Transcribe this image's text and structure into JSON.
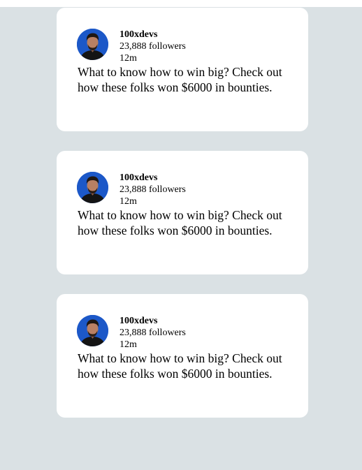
{
  "colors": {
    "background": "#dae1e4",
    "card": "#ffffff",
    "avatar_ring": "#1c58c8"
  },
  "posts": [
    {
      "author": "100xdevs",
      "followers": "23,888 followers",
      "time": "12m",
      "text": "What to know how to win big? Check out how these folks won $6000 in bounties."
    },
    {
      "author": "100xdevs",
      "followers": "23,888 followers",
      "time": "12m",
      "text": "What to know how to win big? Check out how these folks won $6000 in bounties."
    },
    {
      "author": "100xdevs",
      "followers": "23,888 followers",
      "time": "12m",
      "text": "What to know how to win big? Check out how these folks won $6000 in bounties."
    }
  ]
}
